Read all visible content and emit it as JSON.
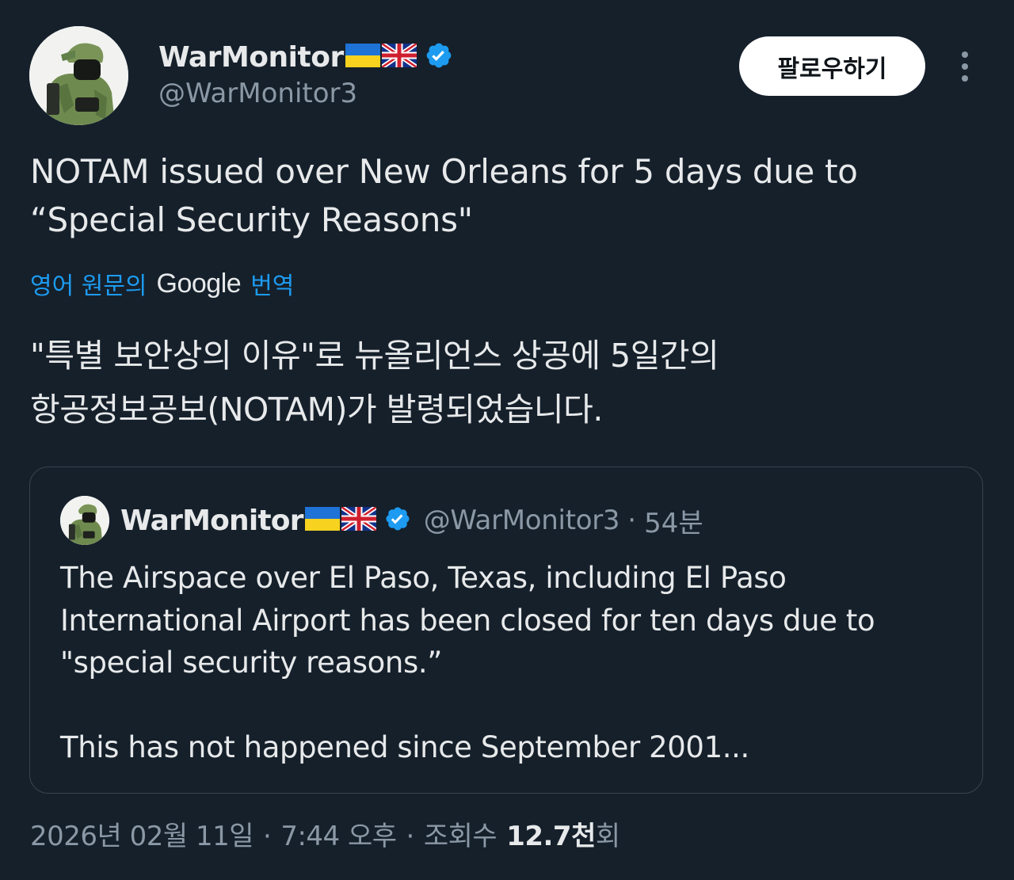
{
  "author": {
    "display_name": "WarMonitor",
    "flags": [
      "ukraine-flag",
      "uk-flag"
    ],
    "verified": true,
    "handle": "@WarMonitor3",
    "avatar_icon": "soldier-avatar"
  },
  "follow_button": {
    "label": "팔로우하기"
  },
  "more_button": {
    "icon": "more-vertical-icon"
  },
  "tweet": {
    "text": "NOTAM issued over New Orleans for 5 days due to\n“Special Security Reasons\"",
    "translate": {
      "label": "영어 원문의",
      "engine": "Google",
      "action": "번역"
    },
    "translated_text": "\"특별 보안상의 이유\"로 뉴올리언스 상공에 5일간의\n항공정보공보(NOTAM)가 발령되었습니다."
  },
  "quote": {
    "display_name": "WarMonitor",
    "handle": "@WarMonitor3",
    "separator": "·",
    "time": "54분",
    "text": "The Airspace over El Paso, Texas, including El Paso\nInternational Airport has been closed for ten days due to\n\"special security reasons.”\n\nThis has not happened since September 2001..."
  },
  "meta": {
    "date": "2026년 02월 11일",
    "separator": "·",
    "time": "7:44 오후",
    "views_label": "조회수",
    "views_count": "12.7천",
    "views_suffix": "회"
  },
  "colors": {
    "background": "#15202b",
    "text": "#e7e9ea",
    "secondary": "#8b98a5",
    "accent": "#1d9bf0",
    "border": "#38444d"
  }
}
